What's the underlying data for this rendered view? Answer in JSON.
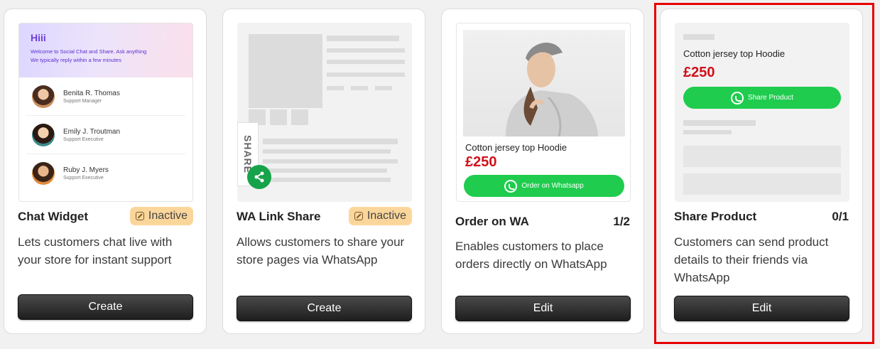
{
  "cards": [
    {
      "title": "Chat Widget",
      "badge": "Inactive",
      "description": "Lets customers chat live with your store for instant support",
      "button": "Create",
      "preview": {
        "greeting": "Hiii",
        "line1": "Welcome to Social Chat and Share. Ask anything",
        "line2": "We typically reply within a few minutes",
        "agents": [
          {
            "name": "Benita R. Thomas",
            "role": "Support Manager"
          },
          {
            "name": "Emily J. Troutman",
            "role": "Support Executive"
          },
          {
            "name": "Ruby J. Myers",
            "role": "Support Executive"
          }
        ]
      }
    },
    {
      "title": "WA Link Share",
      "badge": "Inactive",
      "description": "Allows customers to share your store pages via WhatsApp",
      "button": "Create",
      "preview": {
        "tab_label": "SHARE"
      }
    },
    {
      "title": "Order on WA",
      "count": "1/2",
      "description": "Enables customers to place orders directly on WhatsApp",
      "button": "Edit",
      "preview": {
        "product": "Cotton jersey top Hoodie",
        "price": "£250",
        "cta": "Order on Whatsapp"
      }
    },
    {
      "title": "Share Product",
      "count": "0/1",
      "description": "Customers can send product details to their friends via WhatsApp",
      "button": "Edit",
      "preview": {
        "product": "Cotton jersey top Hoodie",
        "price": "£250",
        "cta": "Share Product"
      }
    }
  ],
  "colors": {
    "accent_green": "#1fcc4e",
    "price_red": "#d0101a",
    "badge_bg": "#fbd69b",
    "highlight": "#e60000"
  }
}
